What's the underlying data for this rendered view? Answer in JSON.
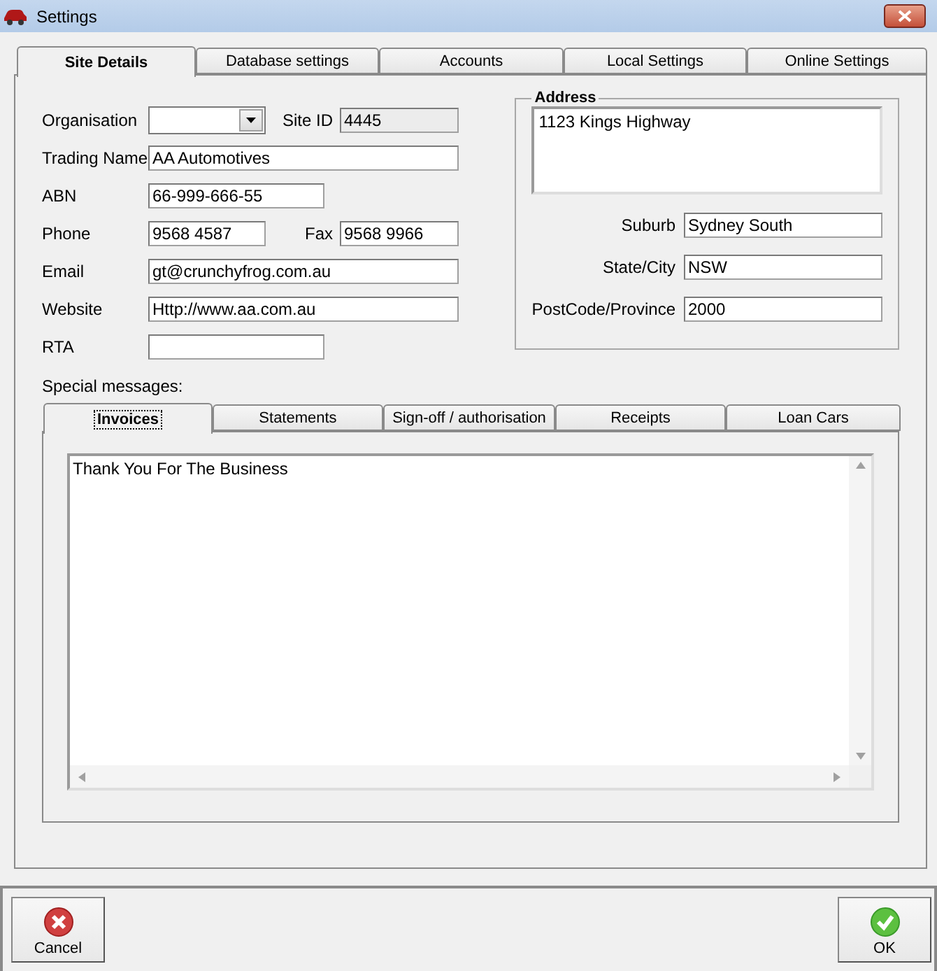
{
  "window": {
    "title": "Settings"
  },
  "tabs": [
    {
      "label": "Site Details",
      "selected": true
    },
    {
      "label": "Database settings",
      "selected": false
    },
    {
      "label": "Accounts",
      "selected": false
    },
    {
      "label": "Local Settings",
      "selected": false
    },
    {
      "label": "Online Settings",
      "selected": false
    }
  ],
  "site_details": {
    "rows": [
      [
        {
          "label": "Organisation",
          "kind": "combo"
        },
        {
          "label": "Site ID",
          "kind": "readonly",
          "value": "4445"
        }
      ],
      [
        {
          "label": "Trading Name",
          "kind": "text",
          "value": "AA Automotives"
        }
      ],
      [
        {
          "label": "ABN",
          "kind": "text",
          "value": "66-999-666-55"
        }
      ],
      [
        {
          "label": "Phone",
          "kind": "text",
          "value": "9568 4587"
        },
        {
          "label": "Fax",
          "kind": "text",
          "value": "9568 9966"
        }
      ],
      [
        {
          "label": "Email",
          "kind": "text",
          "value": "gt@crunchyfrog.com.au"
        }
      ],
      [
        {
          "label": "Website",
          "kind": "text",
          "value": "Http://www.aa.com.au"
        }
      ],
      [
        {
          "label": "RTA",
          "kind": "text"
        }
      ]
    ]
  },
  "address": {
    "title": "Address",
    "street": "1123 Kings Highway",
    "fields": [
      {
        "label": "Suburb",
        "value": "Sydney South"
      },
      {
        "label": "State/City",
        "value": "NSW"
      },
      {
        "label": "PostCode/Province",
        "value": "2000"
      }
    ]
  },
  "special_messages": {
    "label": "Special messages:",
    "tabs": [
      {
        "label": "Invoices",
        "selected": true
      },
      {
        "label": "Statements",
        "selected": false
      },
      {
        "label": "Sign-off / authorisation",
        "selected": false
      },
      {
        "label": "Receipts",
        "selected": false
      },
      {
        "label": "Loan Cars",
        "selected": false
      }
    ],
    "text": "Thank You For The Business"
  },
  "buttons": [
    {
      "label": "Cancel",
      "kind": "cancel"
    },
    {
      "label": "OK",
      "kind": "ok"
    }
  ]
}
